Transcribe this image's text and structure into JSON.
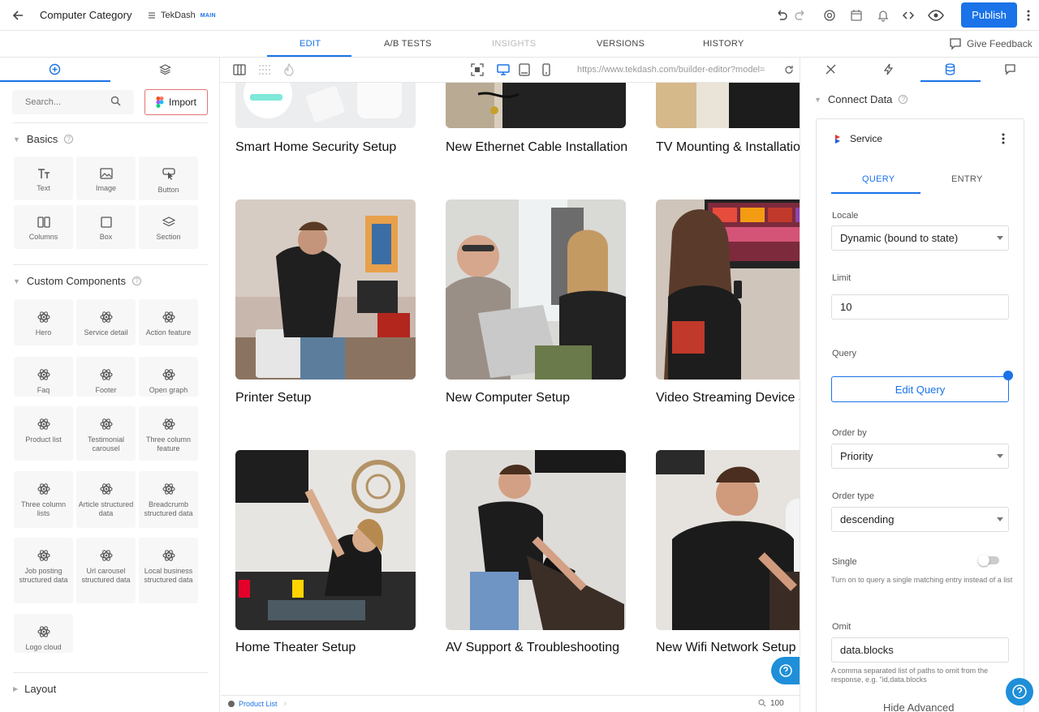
{
  "topbar": {
    "title": "Computer Category",
    "space_name": "TekDash",
    "space_badge": "MAIN",
    "publish_label": "Publish"
  },
  "tabs": [
    {
      "label": "EDIT",
      "state": "active"
    },
    {
      "label": "A/B TESTS",
      "state": "normal"
    },
    {
      "label": "INSIGHTS",
      "state": "disabled"
    },
    {
      "label": "VERSIONS",
      "state": "normal"
    },
    {
      "label": "HISTORY",
      "state": "normal"
    }
  ],
  "feedback_label": "Give Feedback",
  "left_panel": {
    "search_placeholder": "Search...",
    "import_label": "Import",
    "basics_title": "Basics",
    "basics": [
      "Text",
      "Image",
      "Button",
      "Columns",
      "Box",
      "Section"
    ],
    "custom_title": "Custom Components",
    "custom": [
      "Hero",
      "Service detail",
      "Action feature",
      "Faq",
      "Footer",
      "Open graph",
      "Product list",
      "Testimonial carousel",
      "Three column feature",
      "Three column lists",
      "Article structured data",
      "Breadcrumb structured data",
      "Job posting structured data",
      "Url carousel structured data",
      "Local business structured data",
      "Logo cloud"
    ],
    "layout_title": "Layout"
  },
  "canvas": {
    "url": "https://www.tekdash.com/builder-editor?model=",
    "cards": [
      "Smart Home Security Setup",
      "New Ethernet Cable Installation",
      "TV Mounting & Installation",
      "Printer Setup",
      "New Computer Setup",
      "Video Streaming Device Setup",
      "Home Theater Setup",
      "AV Support & Troubleshooting",
      "New Wifi Network Setup"
    ],
    "breadcrumb": "Product List",
    "zoom": "100"
  },
  "right_panel": {
    "connect_title": "Connect Data",
    "model_name": "Service",
    "tab_query": "QUERY",
    "tab_entry": "ENTRY",
    "locale_label": "Locale",
    "locale_value": "Dynamic (bound to state)",
    "limit_label": "Limit",
    "limit_value": "10",
    "query_label": "Query",
    "edit_query_label": "Edit Query",
    "order_by_label": "Order by",
    "order_by_value": "Priority",
    "order_type_label": "Order type",
    "order_type_value": "descending",
    "single_label": "Single",
    "single_on": false,
    "single_help": "Turn on to query a single matching entry instead of a list",
    "omit_label": "Omit",
    "omit_value": "data.blocks",
    "omit_help": "A comma separated list of paths to omit from the response, e.g. \"id,data.blocks",
    "hide_advanced": "Hide Advanced"
  },
  "colors": {
    "accent": "#1a73e8",
    "import_border": "#e57373"
  }
}
